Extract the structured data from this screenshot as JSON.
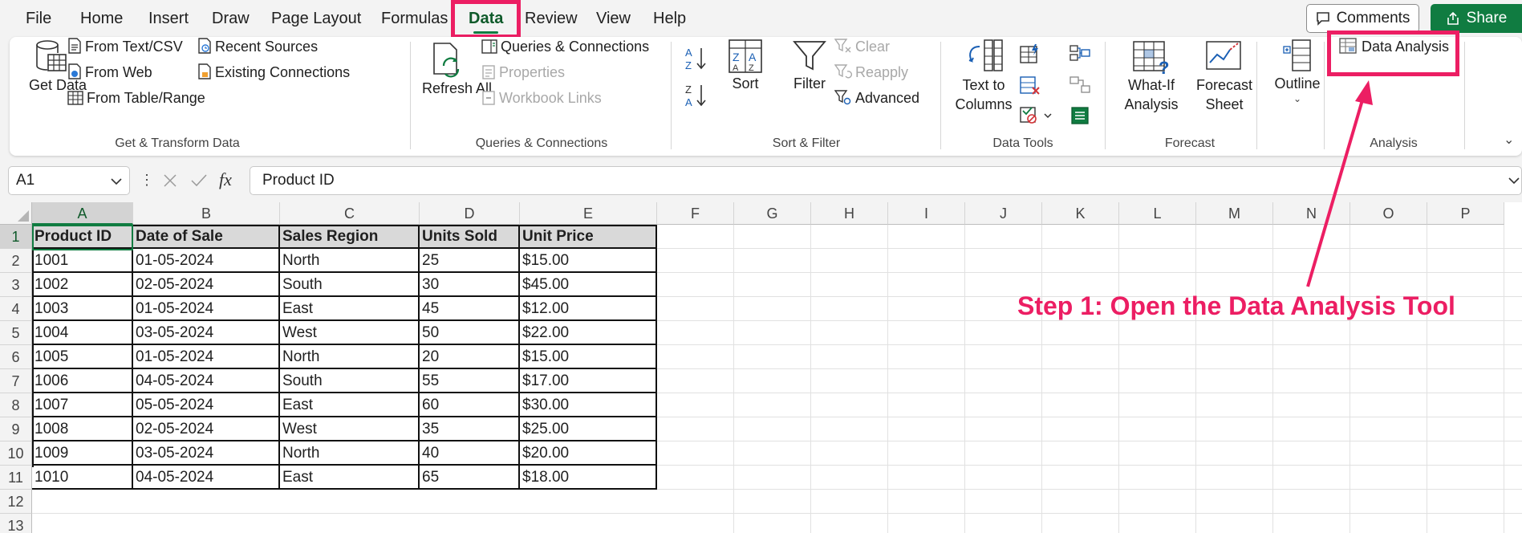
{
  "menu": {
    "tabs": [
      "File",
      "Home",
      "Insert",
      "Draw",
      "Page Layout",
      "Formulas",
      "Data",
      "Review",
      "View",
      "Help"
    ],
    "active_tab": "Data",
    "comments_label": "Comments",
    "share_label": "Share"
  },
  "ribbon": {
    "get_transform": {
      "get_data": "Get Data",
      "from_text_csv": "From Text/CSV",
      "from_web": "From Web",
      "from_table_range": "From Table/Range",
      "recent_sources": "Recent Sources",
      "existing_connections": "Existing Connections",
      "group_label": "Get & Transform Data"
    },
    "queries": {
      "refresh_all": "Refresh All",
      "queries_connections": "Queries & Connections",
      "properties": "Properties",
      "workbook_links": "Workbook Links",
      "group_label": "Queries & Connections"
    },
    "sort_filter": {
      "sort": "Sort",
      "filter": "Filter",
      "clear": "Clear",
      "reapply": "Reapply",
      "advanced": "Advanced",
      "group_label": "Sort & Filter"
    },
    "data_tools": {
      "text_to_columns": "Text to Columns",
      "group_label": "Data Tools"
    },
    "forecast": {
      "what_if": "What-If Analysis",
      "forecast_sheet": "Forecast Sheet",
      "group_label": "Forecast"
    },
    "outline": {
      "outline": "Outline"
    },
    "analysis": {
      "data_analysis": "Data Analysis",
      "group_label": "Analysis"
    }
  },
  "formula_bar": {
    "name_box": "A1",
    "fx": "fx",
    "formula": "Product ID"
  },
  "sheet": {
    "columns": [
      "A",
      "B",
      "C",
      "D",
      "E",
      "F",
      "G",
      "H",
      "I",
      "J",
      "K",
      "L",
      "M",
      "N",
      "O",
      "P"
    ],
    "rows": [
      "1",
      "2",
      "3",
      "4",
      "5",
      "6",
      "7",
      "8",
      "9",
      "10",
      "11",
      "12",
      "13"
    ],
    "header": [
      "Product ID",
      "Date of Sale",
      "Sales Region",
      "Units Sold",
      "Unit Price"
    ],
    "data": [
      [
        "1001",
        "01-05-2024",
        "North",
        "25",
        "$15.00"
      ],
      [
        "1002",
        "02-05-2024",
        "South",
        "30",
        "$45.00"
      ],
      [
        "1003",
        "01-05-2024",
        "East",
        "45",
        "$12.00"
      ],
      [
        "1004",
        "03-05-2024",
        "West",
        "50",
        "$22.00"
      ],
      [
        "1005",
        "01-05-2024",
        "North",
        "20",
        "$15.00"
      ],
      [
        "1006",
        "04-05-2024",
        "South",
        "55",
        "$17.00"
      ],
      [
        "1007",
        "05-05-2024",
        "East",
        "60",
        "$30.00"
      ],
      [
        "1008",
        "02-05-2024",
        "West",
        "35",
        "$25.00"
      ],
      [
        "1009",
        "03-05-2024",
        "North",
        "40",
        "$20.00"
      ],
      [
        "1010",
        "04-05-2024",
        "East",
        "65",
        "$18.00"
      ]
    ]
  },
  "annotation": {
    "step_text": "Step 1: Open the Data Analysis Tool",
    "color": "#ec1e63"
  },
  "colors": {
    "accent": "#107c41",
    "highlight": "#ec1e63"
  }
}
